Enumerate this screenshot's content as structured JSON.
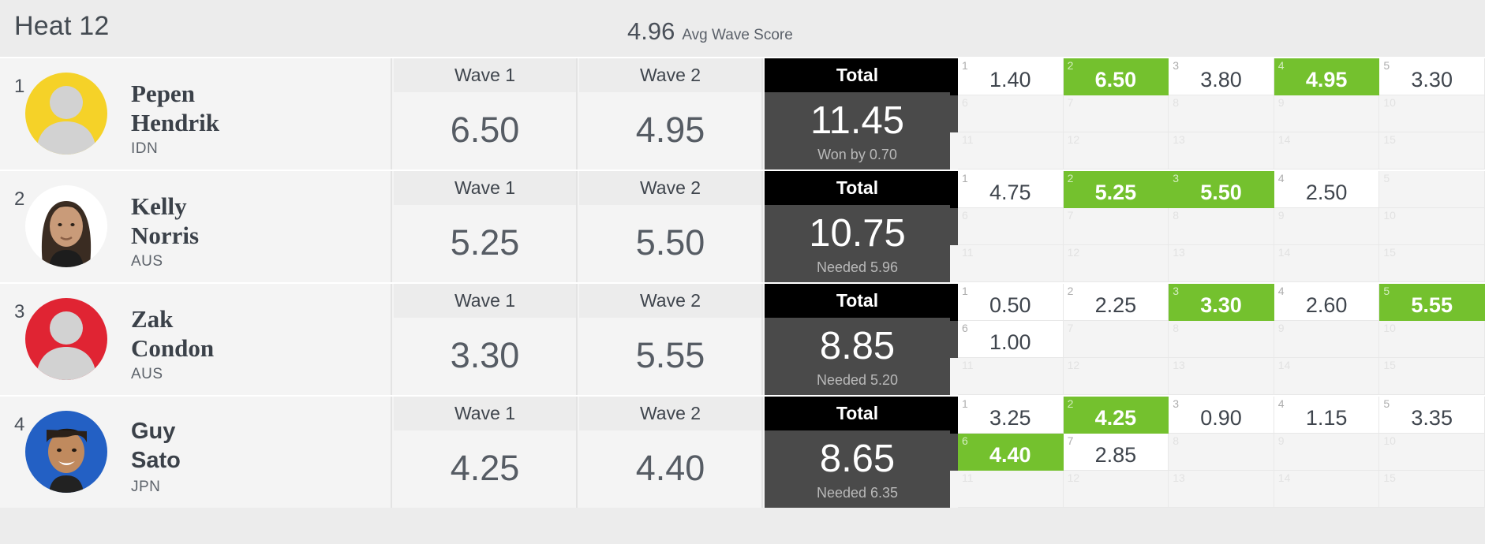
{
  "header": {
    "heat_title": "Heat 12",
    "avg_value": "4.96",
    "avg_label": "Avg Wave Score"
  },
  "columns": {
    "wave1_label": "Wave 1",
    "wave2_label": "Wave 2",
    "total_label": "Total"
  },
  "colors": {
    "counted_green": "#74c12e",
    "total_header": "#000000",
    "total_body": "#4a4a4a",
    "row_background": "#f4f4f4",
    "page_background": "#ececec"
  },
  "athletes": [
    {
      "rank": "1",
      "first_name": "Pepen",
      "last_name": "Hendrik",
      "country": "IDN",
      "jersey_color": "#f5d228",
      "name_font": "serif",
      "avatar_type": "silhouette",
      "wave1": "6.50",
      "wave2": "4.95",
      "total": "11.45",
      "total_note": "Won by 0.70",
      "waves": [
        {
          "slot": "1",
          "value": "1.40",
          "counted": false
        },
        {
          "slot": "2",
          "value": "6.50",
          "counted": true
        },
        {
          "slot": "3",
          "value": "3.80",
          "counted": false
        },
        {
          "slot": "4",
          "value": "4.95",
          "counted": true
        },
        {
          "slot": "5",
          "value": "3.30",
          "counted": false
        },
        {
          "slot": "6",
          "value": "",
          "counted": false
        },
        {
          "slot": "7",
          "value": "",
          "counted": false
        },
        {
          "slot": "8",
          "value": "",
          "counted": false
        },
        {
          "slot": "9",
          "value": "",
          "counted": false
        },
        {
          "slot": "10",
          "value": "",
          "counted": false
        },
        {
          "slot": "11",
          "value": "",
          "counted": false
        },
        {
          "slot": "12",
          "value": "",
          "counted": false
        },
        {
          "slot": "13",
          "value": "",
          "counted": false
        },
        {
          "slot": "14",
          "value": "",
          "counted": false
        },
        {
          "slot": "15",
          "value": "",
          "counted": false
        }
      ]
    },
    {
      "rank": "2",
      "first_name": "Kelly",
      "last_name": "Norris",
      "country": "AUS",
      "jersey_color": "#ffffff",
      "name_font": "serif",
      "avatar_type": "photo-male-long-hair",
      "wave1": "5.25",
      "wave2": "5.50",
      "total": "10.75",
      "total_note": "Needed 5.96",
      "waves": [
        {
          "slot": "1",
          "value": "4.75",
          "counted": false
        },
        {
          "slot": "2",
          "value": "5.25",
          "counted": true
        },
        {
          "slot": "3",
          "value": "5.50",
          "counted": true
        },
        {
          "slot": "4",
          "value": "2.50",
          "counted": false
        },
        {
          "slot": "5",
          "value": "",
          "counted": false
        },
        {
          "slot": "6",
          "value": "",
          "counted": false
        },
        {
          "slot": "7",
          "value": "",
          "counted": false
        },
        {
          "slot": "8",
          "value": "",
          "counted": false
        },
        {
          "slot": "9",
          "value": "",
          "counted": false
        },
        {
          "slot": "10",
          "value": "",
          "counted": false
        },
        {
          "slot": "11",
          "value": "",
          "counted": false
        },
        {
          "slot": "12",
          "value": "",
          "counted": false
        },
        {
          "slot": "13",
          "value": "",
          "counted": false
        },
        {
          "slot": "14",
          "value": "",
          "counted": false
        },
        {
          "slot": "15",
          "value": "",
          "counted": false
        }
      ]
    },
    {
      "rank": "3",
      "first_name": "Zak",
      "last_name": "Condon",
      "country": "AUS",
      "jersey_color": "#e02433",
      "name_font": "serif",
      "avatar_type": "silhouette",
      "wave1": "3.30",
      "wave2": "5.55",
      "total": "8.85",
      "total_note": "Needed 5.20",
      "waves": [
        {
          "slot": "1",
          "value": "0.50",
          "counted": false
        },
        {
          "slot": "2",
          "value": "2.25",
          "counted": false
        },
        {
          "slot": "3",
          "value": "3.30",
          "counted": true
        },
        {
          "slot": "4",
          "value": "2.60",
          "counted": false
        },
        {
          "slot": "5",
          "value": "5.55",
          "counted": true
        },
        {
          "slot": "6",
          "value": "1.00",
          "counted": false
        },
        {
          "slot": "7",
          "value": "",
          "counted": false
        },
        {
          "slot": "8",
          "value": "",
          "counted": false
        },
        {
          "slot": "9",
          "value": "",
          "counted": false
        },
        {
          "slot": "10",
          "value": "",
          "counted": false
        },
        {
          "slot": "11",
          "value": "",
          "counted": false
        },
        {
          "slot": "12",
          "value": "",
          "counted": false
        },
        {
          "slot": "13",
          "value": "",
          "counted": false
        },
        {
          "slot": "14",
          "value": "",
          "counted": false
        },
        {
          "slot": "15",
          "value": "",
          "counted": false
        }
      ]
    },
    {
      "rank": "4",
      "first_name": "Guy",
      "last_name": "Sato",
      "country": "JPN",
      "jersey_color": "#2360c4",
      "name_font": "sans",
      "avatar_type": "photo-male-smiling",
      "wave1": "4.25",
      "wave2": "4.40",
      "total": "8.65",
      "total_note": "Needed 6.35",
      "waves": [
        {
          "slot": "1",
          "value": "3.25",
          "counted": false
        },
        {
          "slot": "2",
          "value": "4.25",
          "counted": true
        },
        {
          "slot": "3",
          "value": "0.90",
          "counted": false
        },
        {
          "slot": "4",
          "value": "1.15",
          "counted": false
        },
        {
          "slot": "5",
          "value": "3.35",
          "counted": false
        },
        {
          "slot": "6",
          "value": "4.40",
          "counted": true
        },
        {
          "slot": "7",
          "value": "2.85",
          "counted": false
        },
        {
          "slot": "8",
          "value": "",
          "counted": false
        },
        {
          "slot": "9",
          "value": "",
          "counted": false
        },
        {
          "slot": "10",
          "value": "",
          "counted": false
        },
        {
          "slot": "11",
          "value": "",
          "counted": false
        },
        {
          "slot": "12",
          "value": "",
          "counted": false
        },
        {
          "slot": "13",
          "value": "",
          "counted": false
        },
        {
          "slot": "14",
          "value": "",
          "counted": false
        },
        {
          "slot": "15",
          "value": "",
          "counted": false
        }
      ]
    }
  ]
}
